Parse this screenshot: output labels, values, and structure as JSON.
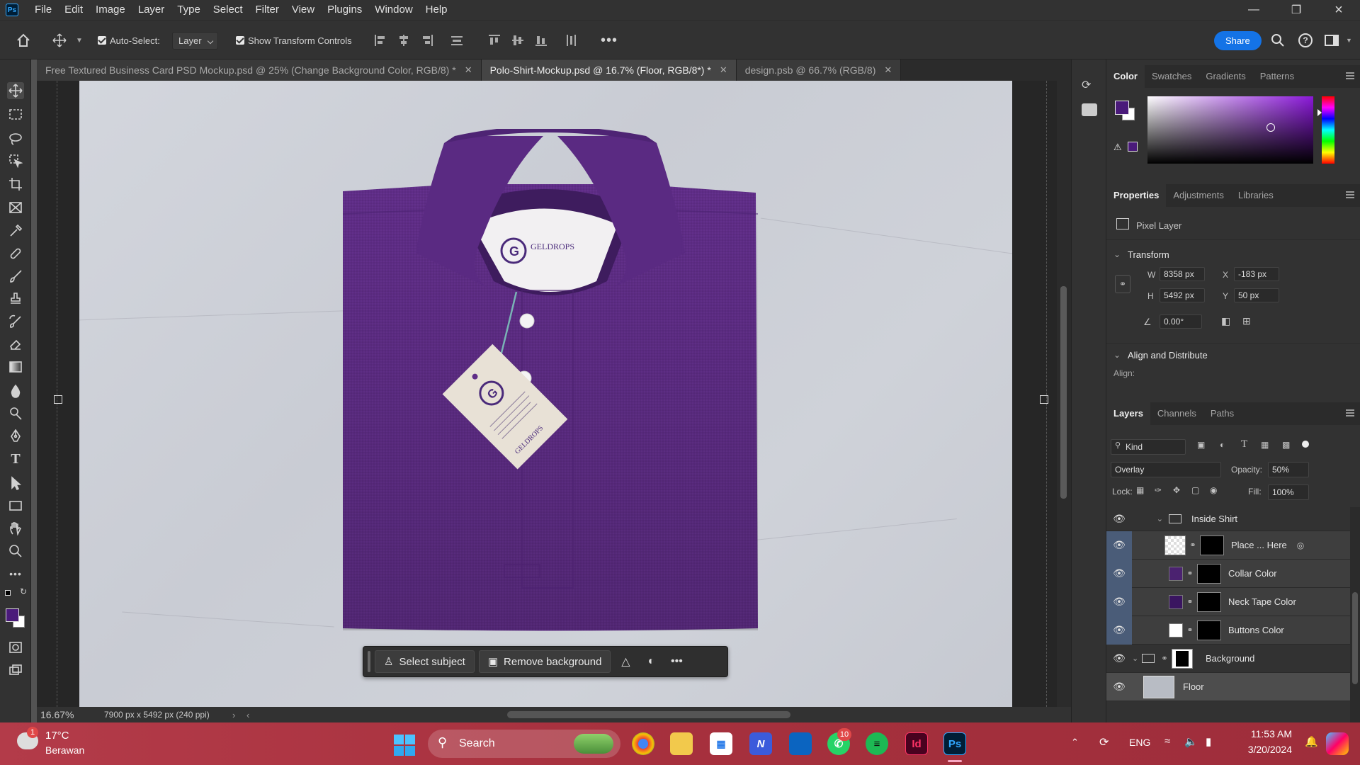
{
  "app": {
    "logo": "Ps",
    "name": "Photoshop"
  },
  "menu": [
    "File",
    "Edit",
    "Image",
    "Layer",
    "Type",
    "Select",
    "Filter",
    "View",
    "Plugins",
    "Window",
    "Help"
  ],
  "options": {
    "auto_select_label": "Auto-Select:",
    "auto_select_value": "Layer",
    "show_transform_label": "Show Transform Controls",
    "share_label": "Share"
  },
  "tabs": [
    {
      "label": "Free Textured Business Card PSD Mockup.psd @ 25% (Change Background Color, RGB/8) *",
      "active": false
    },
    {
      "label": "Polo-Shirt-Mockup.psd @ 16.7% (Floor, RGB/8*) *",
      "active": true
    },
    {
      "label": "design.psb @ 66.7% (RGB/8)",
      "active": false
    }
  ],
  "mockup": {
    "collar_brand": "GELDROPS",
    "tag_brand": "GELDROPS",
    "shirt_color": "#5f2d87"
  },
  "context_bar": {
    "select_subject": "Select subject",
    "remove_background": "Remove background",
    "more": "•••"
  },
  "status": {
    "zoom": "16.67%",
    "doc_info": "7900 px x 5492 px (240 ppi)"
  },
  "color_panel": {
    "tabs": [
      "Color",
      "Swatches",
      "Gradients",
      "Patterns"
    ],
    "foreground": "#4a1a7a",
    "background": "#ffffff"
  },
  "properties_panel": {
    "tabs": [
      "Properties",
      "Adjustments",
      "Libraries"
    ],
    "layer_type": "Pixel Layer",
    "transform_label": "Transform",
    "w_label": "W",
    "w_value": "8358 px",
    "h_label": "H",
    "h_value": "5492 px",
    "x_label": "X",
    "x_value": "-183 px",
    "y_label": "Y",
    "y_value": "50 px",
    "angle_value": "0.00°",
    "align_label": "Align and Distribute",
    "align_sub": "Align:"
  },
  "layers_panel": {
    "tabs": [
      "Layers",
      "Channels",
      "Paths"
    ],
    "kind_label": "Kind",
    "blend_mode": "Overlay",
    "opacity_label": "Opacity:",
    "opacity_value": "50%",
    "lock_label": "Lock:",
    "fill_label": "Fill:",
    "fill_value": "100%",
    "layers": [
      {
        "name": "Inside Shirt",
        "type": "group"
      },
      {
        "name": "Place ... Here",
        "type": "smart"
      },
      {
        "name": "Collar Color",
        "type": "fill",
        "swatch": "#4b2270"
      },
      {
        "name": "Neck Tape Color",
        "type": "fill",
        "swatch": "#3a1560"
      },
      {
        "name": "Buttons Color",
        "type": "fill",
        "swatch": "#ffffff"
      },
      {
        "name": "Background",
        "type": "group"
      },
      {
        "name": "Floor",
        "type": "pixel"
      }
    ]
  },
  "taskbar": {
    "weather_temp": "17°C",
    "weather_desc": "Berawan",
    "weather_badge": "1",
    "search_label": "Search",
    "whatsapp_badge": "10",
    "language": "ENG",
    "time": "11:53 AM",
    "date": "3/20/2024"
  }
}
